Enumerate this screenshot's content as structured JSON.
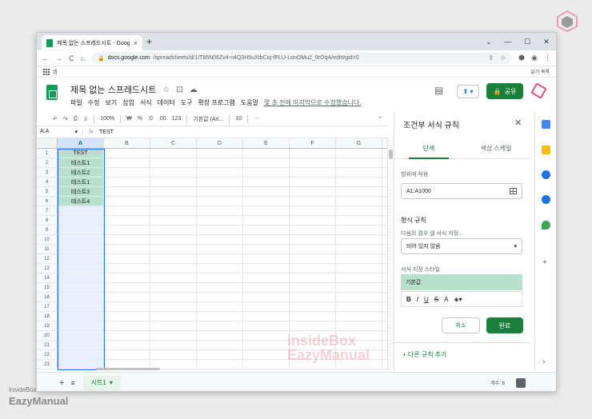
{
  "browser": {
    "tab_title": "제목 없는 스프레드시트 - Goog",
    "tab_close": "×",
    "new_tab": "+",
    "window_controls": [
      "⌄",
      "—",
      "☐",
      "✕"
    ],
    "nav_icons": [
      "←",
      "→",
      "C",
      "⌂"
    ],
    "url_prefix": "docs.google.com",
    "url_rest": "/spreadsheets/d/1IT85N06Zv4-n4Q3H5uXtbCiq-fPLU-LonOMu2_9rOqA/edit#gid=0",
    "bookmarks_app_label": "앱",
    "bookmarks_reading_list": "읽기 목록"
  },
  "doc": {
    "title": "제목 없는 스프레드시트",
    "title_icons": [
      "☆",
      "⊡",
      "☁"
    ],
    "menus": [
      "파일",
      "수정",
      "보기",
      "삽입",
      "서식",
      "데이터",
      "도구",
      "확장 프로그램",
      "도움말"
    ],
    "last_edit": "몇 초 전에 마지막으로 수정했습니다.",
    "share_label": "공유",
    "share_icon": "🔒"
  },
  "toolbar": {
    "items": [
      "↶",
      "↷",
      "⎙",
      "⇩",
      "100%",
      "₩",
      "%",
      ".0",
      ".00",
      "123",
      "기본값 (Ari...",
      "10",
      "···"
    ],
    "chevron": "⌃"
  },
  "formula": {
    "name_box": "A:A",
    "fx": "fx",
    "value": "TEST"
  },
  "grid": {
    "columns": [
      "A",
      "B",
      "C",
      "D",
      "E",
      "F",
      "G"
    ],
    "rows": [
      "1",
      "2",
      "3",
      "4",
      "5",
      "6",
      "7",
      "8",
      "9",
      "10",
      "11",
      "12",
      "13",
      "14",
      "15",
      "16",
      "17",
      "18",
      "19",
      "20",
      "21",
      "22",
      "23"
    ],
    "a_values": [
      "TEST",
      "테스트1",
      "테스트2",
      "테스트1",
      "테스트3",
      "테스트4"
    ]
  },
  "sheetbar": {
    "add": "+",
    "all": "≡",
    "sheet_name": "시트1",
    "count": "개수: 6"
  },
  "panel": {
    "title": "조건부 서식 규칙",
    "close": "✕",
    "tab_single": "단색",
    "tab_scale": "색상 스케일",
    "range_label": "범위에 적용",
    "range_value": "A1:A1000",
    "rules_heading": "형식 규칙",
    "condition_label": "다음의 경우 셀 서식 지정...",
    "condition_value": "비어 있지 않음",
    "style_label": "서식 지정 스타일",
    "style_value": "기본값",
    "format_buttons": [
      "B",
      "I",
      "U",
      "S",
      "A"
    ],
    "cancel": "취소",
    "done": "완료",
    "add_rule": "+ 다른 규칙 추가"
  },
  "watermark": {
    "center_line1": "insideBox",
    "center_line2": "EazyManual",
    "corner_line1": "insideBox",
    "corner_line2": "EazyManual"
  },
  "colors": {
    "green": "#188038",
    "highlight": "#b7e1cd",
    "selection": "#1a73e8"
  }
}
